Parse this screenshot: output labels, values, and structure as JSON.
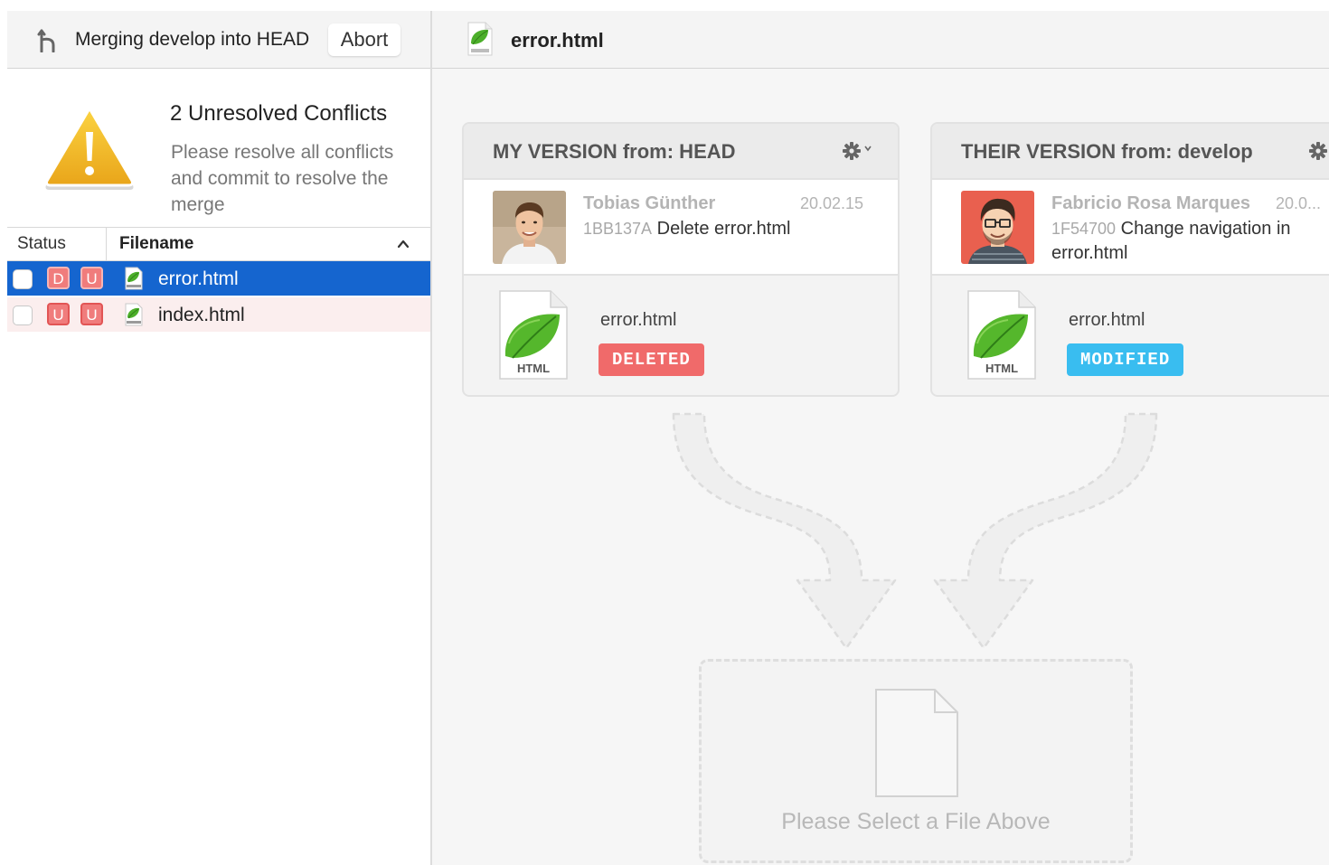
{
  "merge_bar": {
    "title": "Merging develop into HEAD",
    "abort_label": "Abort"
  },
  "conflicts": {
    "title": "2 Unresolved Conflicts",
    "description": "Please resolve all conflicts and commit to resolve the merge"
  },
  "file_table": {
    "headers": {
      "status": "Status",
      "filename": "Filename"
    },
    "sort_direction": "ascending",
    "rows": [
      {
        "checked": false,
        "badges": [
          "D",
          "U"
        ],
        "filename": "error.html",
        "selected": true
      },
      {
        "checked": false,
        "badges": [
          "U",
          "U"
        ],
        "filename": "index.html",
        "selected": false
      }
    ]
  },
  "selected_file": {
    "name": "error.html"
  },
  "my_version": {
    "title": "MY VERSION from: HEAD",
    "author": "Tobias Günther",
    "date": "20.02.15",
    "hash": "1BB137A",
    "message": "Delete error.html",
    "file_type": "HTML",
    "filename": "error.html",
    "status": "DELETED"
  },
  "their_version": {
    "title": "THEIR VERSION from: develop",
    "author": "Fabricio Rosa Marques",
    "date": "20.0...",
    "hash": "1F54700",
    "message": "Change navigation in error.html",
    "file_type": "HTML",
    "filename": "error.html",
    "status": "MODIFIED"
  },
  "result": {
    "placeholder": "Please Select a File Above"
  },
  "colors": {
    "selection": "#1565cf",
    "conflict_row": "#fbeeee",
    "badge": "#f07c7c",
    "deleted": "#f06a6a",
    "modified": "#39bdf0",
    "leaf_green": "#4caf2a"
  }
}
